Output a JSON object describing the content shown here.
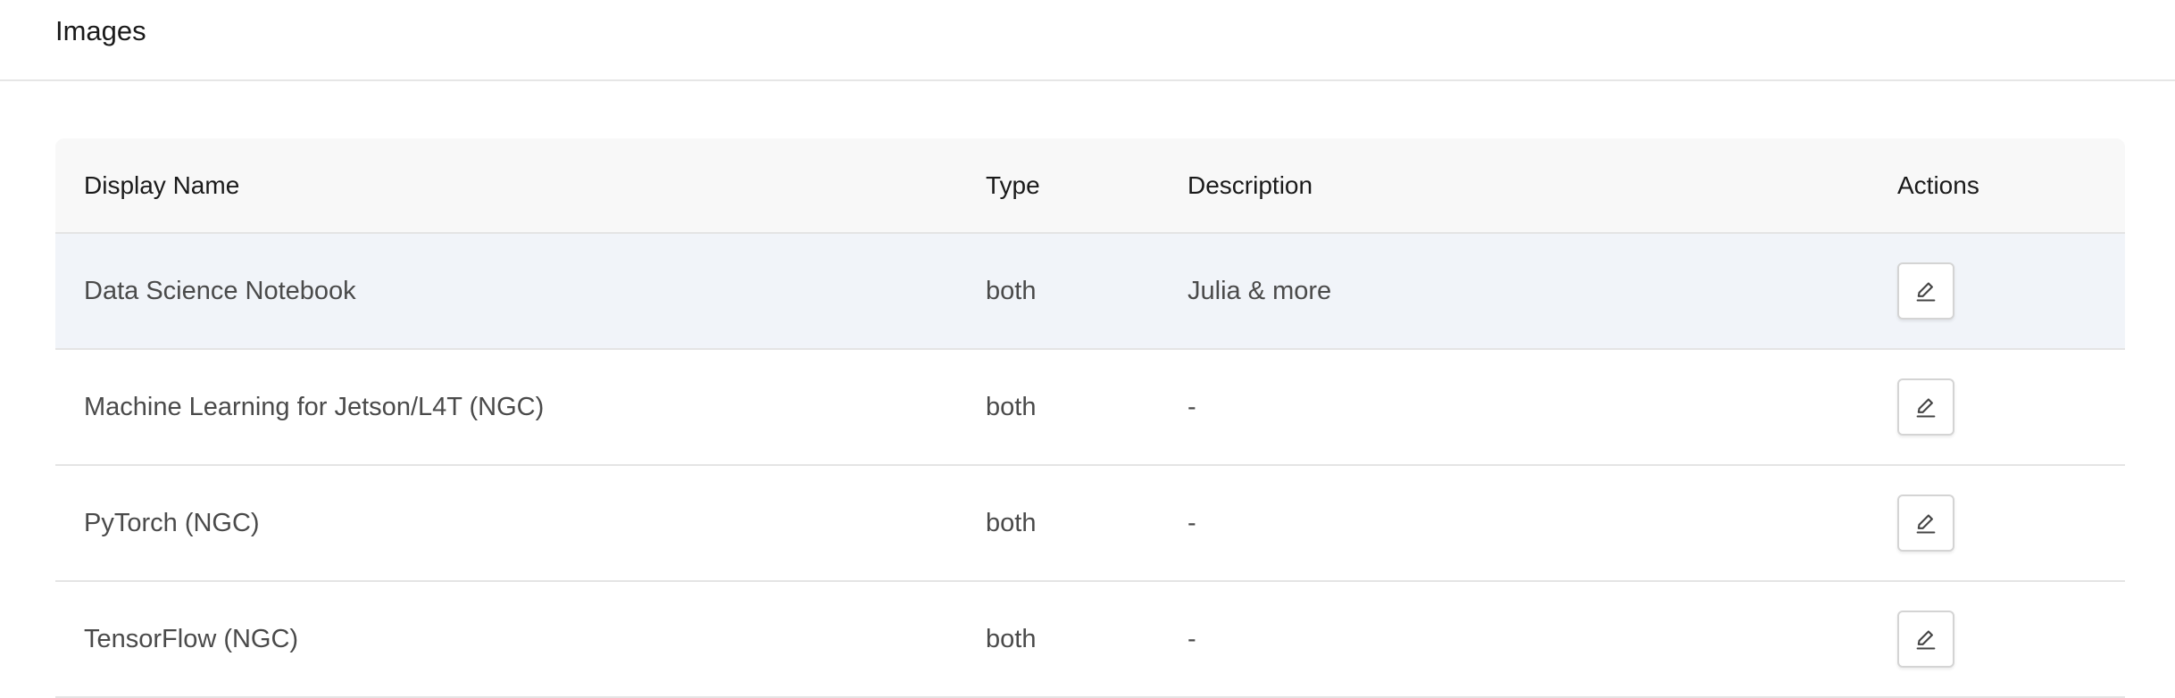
{
  "page": {
    "title": "Images"
  },
  "table": {
    "columns": [
      "Display Name",
      "Type",
      "Description",
      "Actions"
    ],
    "rows": [
      {
        "display_name": "Data Science Notebook",
        "type": "both",
        "description": "Julia & more",
        "action_icon": "pencil-edit-icon"
      },
      {
        "display_name": "Machine Learning for Jetson/L4T (NGC)",
        "type": "both",
        "description": "-",
        "action_icon": "pencil-edit-icon"
      },
      {
        "display_name": "PyTorch (NGC)",
        "type": "both",
        "description": "-",
        "action_icon": "pencil-edit-icon"
      },
      {
        "display_name": "TensorFlow (NGC)",
        "type": "both",
        "description": "-",
        "action_icon": "pencil-edit-icon"
      }
    ]
  },
  "colors": {
    "header_bg": "#f8f8f8",
    "highlight_row_bg": "#f1f4f9",
    "border": "#e4e4e4",
    "text_primary": "#1a1a1a",
    "text_secondary": "#4a4a4a"
  }
}
